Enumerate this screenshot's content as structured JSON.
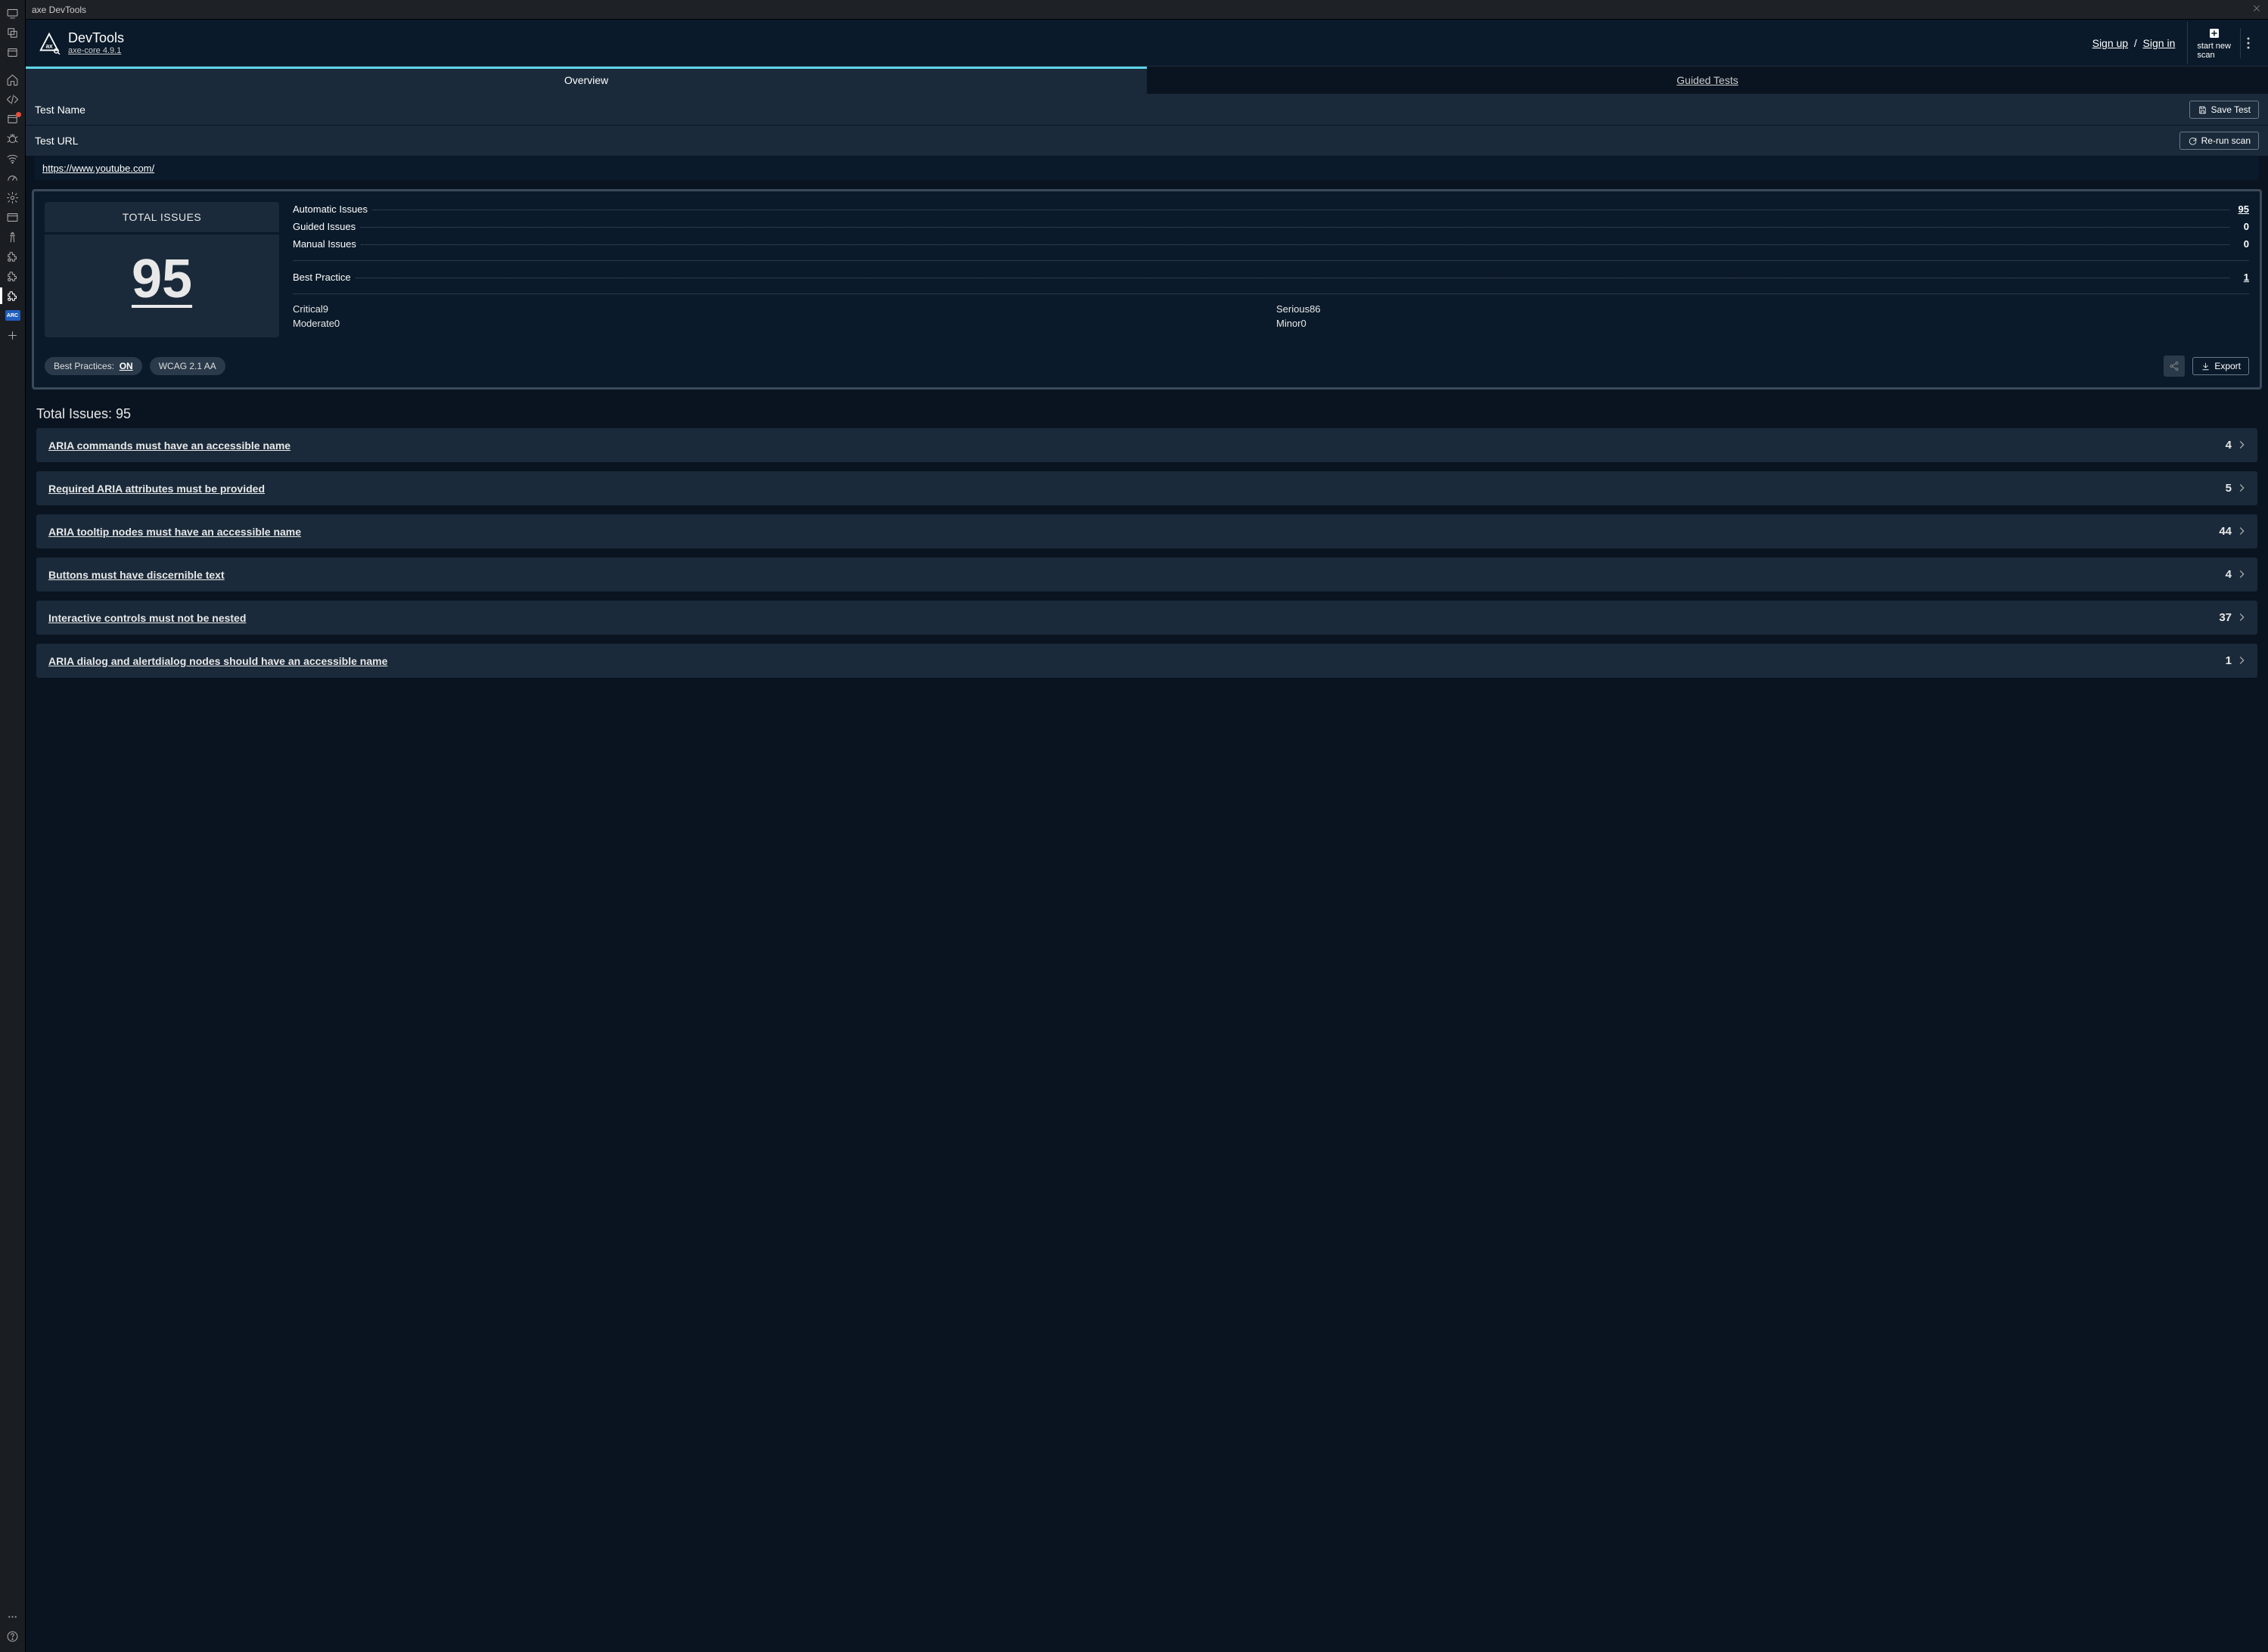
{
  "titlebar": {
    "title": "axe DevTools"
  },
  "brand": {
    "name": "DevTools",
    "subtitle_prefix": "axe-core",
    "subtitle_version": " 4.9.1"
  },
  "auth": {
    "signup": "Sign up",
    "signin": "Sign in",
    "sep": "/"
  },
  "start_scan": {
    "line1": "start new",
    "line2": "scan"
  },
  "tabs": {
    "overview": "Overview",
    "guided": "Guided Tests"
  },
  "meta": {
    "test_name_label": "Test Name",
    "test_url_label": "Test URL",
    "save_btn": "Save Test",
    "rerun_btn": "Re-run scan",
    "url": "https://www.youtube.com/"
  },
  "total": {
    "label": "TOTAL ISSUES",
    "value": "95"
  },
  "summary_rows": {
    "automatic": {
      "label": "Automatic Issues",
      "value": "95"
    },
    "guided": {
      "label": "Guided Issues",
      "value": "0"
    },
    "manual": {
      "label": "Manual Issues",
      "value": "0"
    },
    "bp": {
      "label": "Best Practice",
      "value": "1"
    },
    "critical": {
      "label": "Critical",
      "value": "9"
    },
    "serious": {
      "label": "Serious",
      "value": "86"
    },
    "moderate": {
      "label": "Moderate",
      "value": "0"
    },
    "minor": {
      "label": "Minor",
      "value": "0"
    }
  },
  "pills": {
    "bp_label": "Best Practices:",
    "bp_value": "ON",
    "wcag": "WCAG 2.1 AA"
  },
  "export_btn": "Export",
  "issues_header_prefix": "Total Issues: ",
  "issues_header_count": "95",
  "issues": [
    {
      "title": "ARIA commands must have an accessible name",
      "count": "4"
    },
    {
      "title": "Required ARIA attributes must be provided",
      "count": "5"
    },
    {
      "title": "ARIA tooltip nodes must have an accessible name",
      "count": "44"
    },
    {
      "title": "Buttons must have discernible text",
      "count": "4"
    },
    {
      "title": "Interactive controls must not be nested",
      "count": "37"
    },
    {
      "title": "ARIA dialog and alertdialog nodes should have an accessible name",
      "count": "1"
    }
  ]
}
